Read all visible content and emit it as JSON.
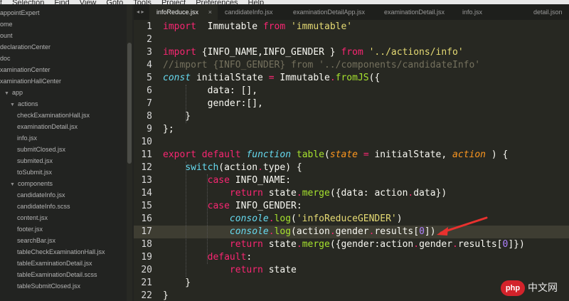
{
  "menu": [
    "t",
    "Selection",
    "Find",
    "View",
    "Goto",
    "Tools",
    "Project",
    "Preferences",
    "Help"
  ],
  "sidebar": {
    "items": [
      {
        "label": "",
        "indent": 0,
        "folder": false
      },
      {
        "label": "appointExpert",
        "indent": 0,
        "folder": false
      },
      {
        "label": "ome",
        "indent": 0,
        "folder": false
      },
      {
        "label": "ount",
        "indent": 0,
        "folder": false
      },
      {
        "label": "declarationCenter",
        "indent": 0,
        "folder": false
      },
      {
        "label": "doc",
        "indent": 0,
        "folder": false
      },
      {
        "label": "xaminationCenter",
        "indent": 0,
        "folder": false
      },
      {
        "label": "xaminationHallCenter",
        "indent": 0,
        "folder": false
      },
      {
        "label": "app",
        "indent": 1,
        "folder": true
      },
      {
        "label": "actions",
        "indent": 2,
        "folder": true
      },
      {
        "label": "checkExaminationHall.jsx",
        "indent": 3,
        "folder": false
      },
      {
        "label": "examinationDetail.jsx",
        "indent": 3,
        "folder": false
      },
      {
        "label": "info.jsx",
        "indent": 3,
        "folder": false
      },
      {
        "label": "submitClosed.jsx",
        "indent": 3,
        "folder": false
      },
      {
        "label": "submited.jsx",
        "indent": 3,
        "folder": false
      },
      {
        "label": "toSubmit.jsx",
        "indent": 3,
        "folder": false
      },
      {
        "label": "components",
        "indent": 2,
        "folder": true
      },
      {
        "label": "candidateInfo.jsx",
        "indent": 3,
        "folder": false
      },
      {
        "label": "candidateInfo.scss",
        "indent": 3,
        "folder": false
      },
      {
        "label": "content.jsx",
        "indent": 3,
        "folder": false
      },
      {
        "label": "footer.jsx",
        "indent": 3,
        "folder": false
      },
      {
        "label": "searchBar.jsx",
        "indent": 3,
        "folder": false
      },
      {
        "label": "tableCheckExaminationHall.jsx",
        "indent": 3,
        "folder": false
      },
      {
        "label": "tableExaminationDetail.jsx",
        "indent": 3,
        "folder": false
      },
      {
        "label": "tableExaminationDetail.scss",
        "indent": 3,
        "folder": false
      },
      {
        "label": "tableSubmitClosed.jsx",
        "indent": 3,
        "folder": false
      }
    ]
  },
  "tabs": [
    {
      "label": "infoReduce.jsx",
      "active": true
    },
    {
      "label": "candidateInfo.jsx",
      "active": false
    },
    {
      "label": "examinationDetailApp.jsx",
      "active": false
    },
    {
      "label": "examinationDetail.jsx",
      "active": false
    },
    {
      "label": "info.jsx",
      "active": false
    },
    {
      "label": "detail.json",
      "active": false
    }
  ],
  "tab_arrows": "◂ ▸",
  "close_glyph": "×",
  "editor": {
    "highlighted_line": 17,
    "line_numbers": [
      "1",
      "2",
      "3",
      "4",
      "5",
      "6",
      "7",
      "8",
      "9",
      "10",
      "11",
      "12",
      "13",
      "14",
      "15",
      "16",
      "17",
      "18",
      "19",
      "20",
      "21",
      "22"
    ],
    "lines": [
      [
        [
          "kw",
          "import"
        ],
        [
          "",
          "  Immutable "
        ],
        [
          "kw",
          "from"
        ],
        [
          "",
          " "
        ],
        [
          "st",
          "'immutable'"
        ]
      ],
      [],
      [
        [
          "kw",
          "import"
        ],
        [
          "",
          " {INFO_NAME,INFO_GENDER } "
        ],
        [
          "kw",
          "from"
        ],
        [
          "",
          " "
        ],
        [
          "st",
          "'../actions/info'"
        ]
      ],
      [
        [
          "cm",
          "//import {INFO_GENDER} from '../components/candidateInfo'"
        ]
      ],
      [
        [
          "it",
          "const"
        ],
        [
          "",
          " initialState "
        ],
        [
          "kw",
          "="
        ],
        [
          "",
          " Immutable"
        ],
        [
          "kw",
          "."
        ],
        [
          "fn",
          "fromJS"
        ],
        [
          "",
          "({"
        ]
      ],
      [
        [
          "",
          "        data: [],"
        ]
      ],
      [
        [
          "",
          "        gender:[],"
        ]
      ],
      [
        [
          "",
          "    }"
        ]
      ],
      [
        [
          "",
          "};"
        ]
      ],
      [],
      [
        [
          "kw",
          "export"
        ],
        [
          "",
          " "
        ],
        [
          "kw",
          "default"
        ],
        [
          "",
          " "
        ],
        [
          "it",
          "function"
        ],
        [
          "",
          " "
        ],
        [
          "fn",
          "table"
        ],
        [
          "",
          "("
        ],
        [
          "pa",
          "state"
        ],
        [
          "",
          " "
        ],
        [
          "kw",
          "="
        ],
        [
          "",
          " initialState, "
        ],
        [
          "pa",
          "action"
        ],
        [
          "",
          " ) {"
        ]
      ],
      [
        [
          "",
          "    "
        ],
        [
          "pr",
          "switch"
        ],
        [
          "",
          "(action"
        ],
        [
          "kw",
          "."
        ],
        [
          "",
          "type) {"
        ]
      ],
      [
        [
          "",
          "        "
        ],
        [
          "kw",
          "case"
        ],
        [
          "",
          " INFO_NAME:"
        ]
      ],
      [
        [
          "",
          "            "
        ],
        [
          "kw",
          "return"
        ],
        [
          "",
          " state"
        ],
        [
          "kw",
          "."
        ],
        [
          "fn",
          "merge"
        ],
        [
          "",
          "({data: action"
        ],
        [
          "kw",
          "."
        ],
        [
          "",
          "data})"
        ]
      ],
      [
        [
          "",
          "        "
        ],
        [
          "kw",
          "case"
        ],
        [
          "",
          " INFO_GENDER:"
        ]
      ],
      [
        [
          "",
          "            "
        ],
        [
          "it",
          "console"
        ],
        [
          "kw",
          "."
        ],
        [
          "fn",
          "log"
        ],
        [
          "",
          "("
        ],
        [
          "st",
          "'infoReduceGENDER'"
        ],
        [
          "",
          ")"
        ]
      ],
      [
        [
          "",
          "            "
        ],
        [
          "it",
          "console"
        ],
        [
          "kw",
          "."
        ],
        [
          "fn",
          "log"
        ],
        [
          "",
          "(action"
        ],
        [
          "kw",
          "."
        ],
        [
          "",
          "gender"
        ],
        [
          "kw",
          "."
        ],
        [
          "",
          "results["
        ],
        [
          "nu",
          "0"
        ],
        [
          "",
          "])"
        ]
      ],
      [
        [
          "",
          "            "
        ],
        [
          "kw",
          "return"
        ],
        [
          "",
          " state"
        ],
        [
          "kw",
          "."
        ],
        [
          "fn",
          "merge"
        ],
        [
          "",
          "({gender:action"
        ],
        [
          "kw",
          "."
        ],
        [
          "",
          "gender"
        ],
        [
          "kw",
          "."
        ],
        [
          "",
          "results["
        ],
        [
          "nu",
          "0"
        ],
        [
          "",
          "]})"
        ]
      ],
      [
        [
          "",
          "        "
        ],
        [
          "kw",
          "default"
        ],
        [
          "",
          ":"
        ]
      ],
      [
        [
          "",
          "            "
        ],
        [
          "kw",
          "return"
        ],
        [
          "",
          " state"
        ]
      ],
      [
        [
          "",
          "    }"
        ]
      ],
      [
        [
          "",
          "}"
        ]
      ]
    ]
  },
  "watermark": {
    "logo": "php",
    "text": "中文网"
  },
  "colors": {
    "arrow": "#e8312e",
    "background": "#272822",
    "highlight": "#3e3d32"
  }
}
